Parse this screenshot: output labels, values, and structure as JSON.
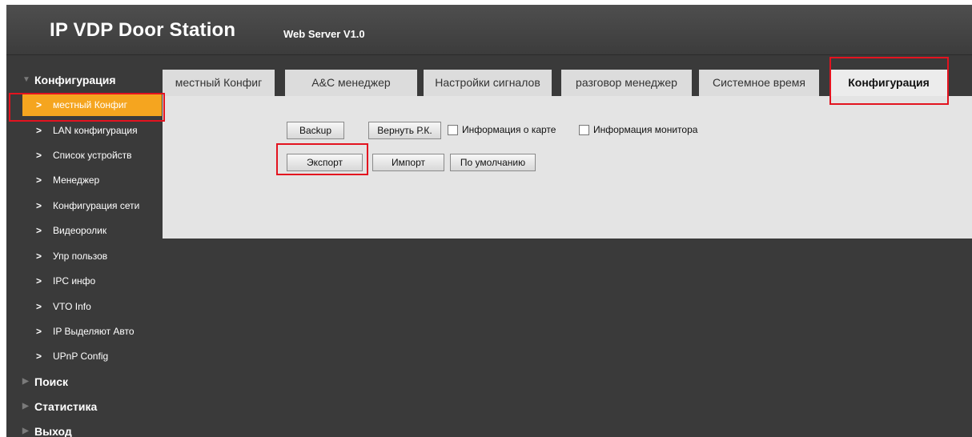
{
  "header": {
    "title": "IP VDP Door Station",
    "subtitle": "Web Server V1.0"
  },
  "sidebar": {
    "config_section": "Конфигурация",
    "items": [
      {
        "label": "местный Конфиг"
      },
      {
        "label": "LAN конфигурация"
      },
      {
        "label": "Список устройств"
      },
      {
        "label": "Менеджер"
      },
      {
        "label": "Конфигурация сети"
      },
      {
        "label": "Видеоролик"
      },
      {
        "label": "Упр пользов"
      },
      {
        "label": "IPC инфо"
      },
      {
        "label": "VTO Info"
      },
      {
        "label": "IP Выделяют Авто"
      },
      {
        "label": "UPnP Config"
      }
    ],
    "search_section": "Поиск",
    "stats_section": "Статистика",
    "exit_section": "Выход",
    "chevron": ">",
    "tri_down": "▼",
    "tri_right": "▶"
  },
  "tabs": [
    {
      "label": "местный Конфиг"
    },
    {
      "label": "A&C менеджер"
    },
    {
      "label": "Настройки сигналов"
    },
    {
      "label": "разговор менеджер"
    },
    {
      "label": "Системное время"
    },
    {
      "label": "Конфигурация"
    }
  ],
  "panel": {
    "backup_label": "Backup",
    "restore_label": "Вернуть Р.К.",
    "card_info_label": "Информация о карте",
    "monitor_info_label": "Информация монитора",
    "export_label": "Экспорт",
    "import_label": "Импорт",
    "default_label": "По умолчанию"
  },
  "colors": {
    "active_item": "#f5a51f",
    "highlight": "#e3131f",
    "background": "#3a3a3a"
  }
}
